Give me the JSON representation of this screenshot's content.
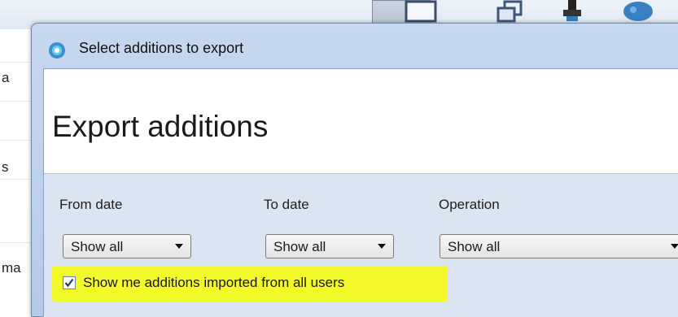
{
  "background": {
    "left_rows": [
      "a",
      "s",
      "ma"
    ]
  },
  "dialog": {
    "title": "Select additions to export",
    "header_title": "Export additions",
    "fields": {
      "from_date": {
        "label": "From date",
        "value": "Show all"
      },
      "to_date": {
        "label": "To date",
        "value": "Show all"
      },
      "operation": {
        "label": "Operation",
        "value": "Show all"
      }
    },
    "show_all_users": {
      "label": "Show me additions imported from all users",
      "checked": true
    }
  },
  "colors": {
    "highlight": "#f4fa2a",
    "dialog_frame": "#b4cbe8",
    "content_bg": "#dbe5f1"
  },
  "icons": [
    "app-icon",
    "checkmark-icon",
    "chevron-down-icon"
  ]
}
